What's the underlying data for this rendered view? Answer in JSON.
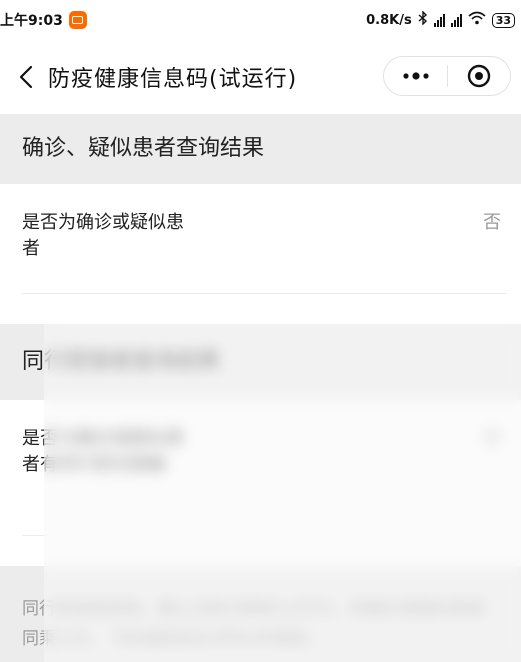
{
  "status_bar": {
    "time": "上午9:03",
    "net_speed": "0.8K/s",
    "battery": "33"
  },
  "nav": {
    "title": "防疫健康信息码(试运行)"
  },
  "section1": {
    "title": "确诊、疑似患者查询结果",
    "row_label": "是否为确诊或疑似患者",
    "row_value": "否"
  },
  "section2": {
    "title": "同行密接者查询结果",
    "row_label": "是否与确诊或疑似患者有同行密切接触",
    "row_value": "否"
  },
  "notice": {
    "text": "同行密接者是指，截止当前日期前14天内，和确诊或疑似患者同乘火车、飞机或航班及(同车)的乘客。"
  }
}
